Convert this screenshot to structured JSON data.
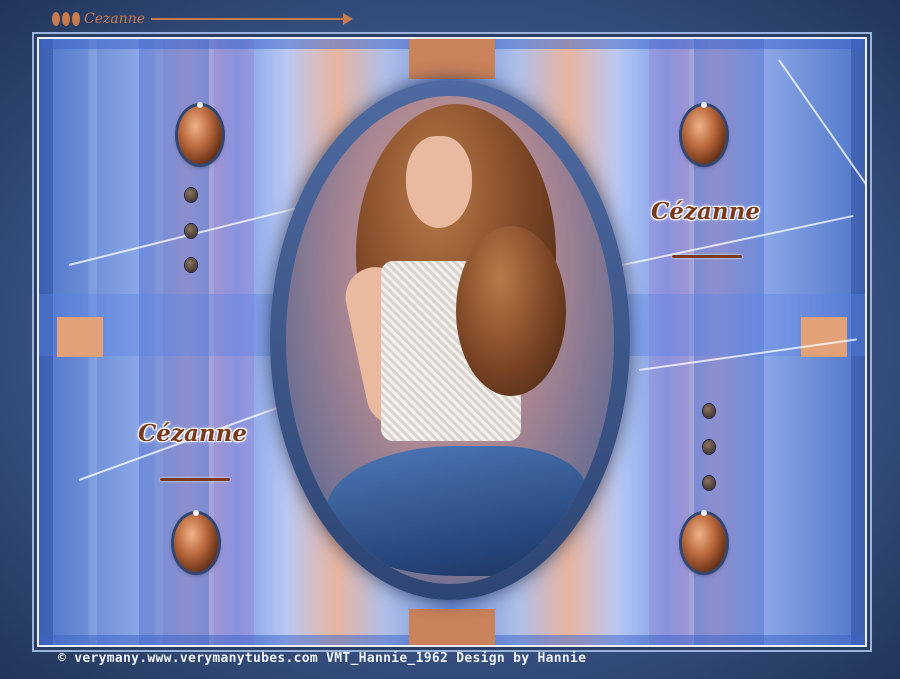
{
  "signature": {
    "name": "Cezanne"
  },
  "logos": {
    "left": "Cézanne",
    "right": "Cézanne"
  },
  "footer": {
    "copyright": "© verymany.www.verymanytubes.com VMT_Hannie_1962 Design by Hannie"
  },
  "colors": {
    "frame": "#3b5688",
    "copper": "#c9825a",
    "accent_blue": "#7da0e9",
    "logo_brown": "#7a3a1c"
  }
}
